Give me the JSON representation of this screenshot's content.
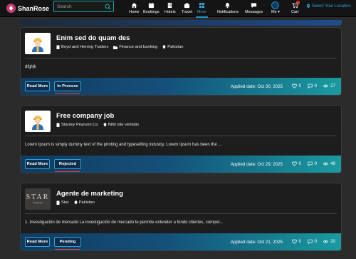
{
  "header": {
    "brand": "ShanRose",
    "search_placeholder": "Search",
    "nav": [
      {
        "label": "Home",
        "icon": "home-icon"
      },
      {
        "label": "Bookings",
        "icon": "calendar-icon"
      },
      {
        "label": "Hotels",
        "icon": "hotel-icon"
      },
      {
        "label": "Travel",
        "icon": "suitcase-icon"
      },
      {
        "label": "More",
        "icon": "grid-icon"
      }
    ],
    "notifications": "Notifications",
    "messages": "Messages",
    "me": "Me ▾",
    "cart": "Cart",
    "location": "Select Your Location"
  },
  "cards": [
    {
      "title": "Enim sed do quam des",
      "company": "Boyd and Herring Traders",
      "industry": "Finance and banking",
      "location": "Pakistan",
      "description": "dfghjk",
      "read_more": "Read More",
      "status": "In Process",
      "applied_date": "Applied date: Oct 30, 2025",
      "likes": "0",
      "comments": "0",
      "views": "27"
    },
    {
      "title": "Free company job",
      "company": "Stanley Pearson Co",
      "location": "Nihil iste veritatis",
      "description": "Lorem Ipsum is simply dummy text of the printing and typesetting industry. Lorem Ipsum has been the ...",
      "read_more": "Read More",
      "status": "Rejected",
      "applied_date": "Applied date: Oct 29, 2025",
      "likes": "0",
      "comments": "0",
      "views": "48"
    },
    {
      "title": "Agente de marketing",
      "company": "Star",
      "location": "Pakistan",
      "logo_text": "STAR",
      "logo_subtext": "Desarrollo",
      "description": "1. Investigación de mercado La investigación de mercado te permite entender a fondo clientes, compet...",
      "read_more": "Read More",
      "status": "Pending",
      "applied_date": "Applied date: Oct 21, 2025",
      "likes": "0",
      "comments": "0",
      "views": "20"
    }
  ],
  "colors": {
    "accent": "#1a9aa0",
    "link": "#2aa3e0",
    "badge": "#e33333",
    "status_underline": "#e0403c"
  }
}
